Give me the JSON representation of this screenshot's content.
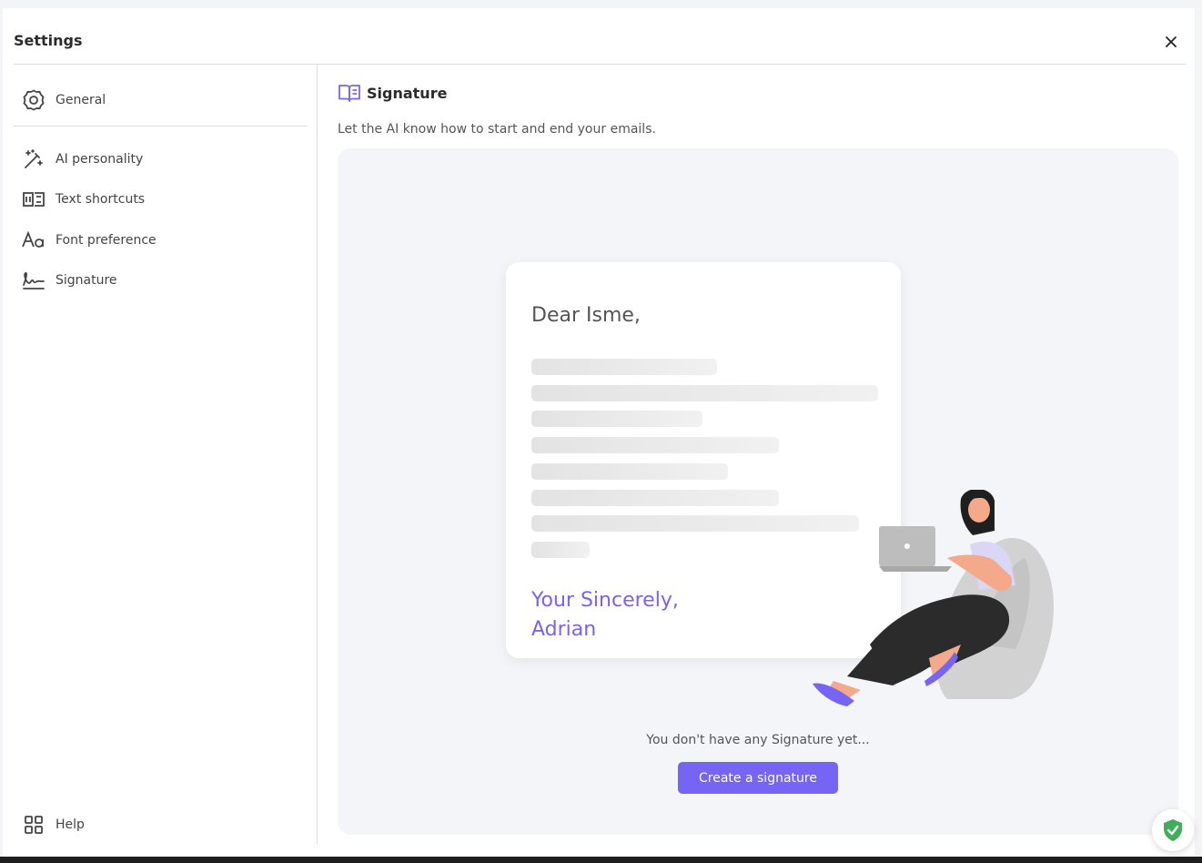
{
  "header": {
    "title": "Settings"
  },
  "sidebar": {
    "items": [
      {
        "label": "General",
        "icon": "gear-icon"
      },
      {
        "label": "AI personality",
        "icon": "magic-wand-icon"
      },
      {
        "label": "Text shortcuts",
        "icon": "text-shortcut-icon"
      },
      {
        "label": "Font preference",
        "icon": "font-icon"
      },
      {
        "label": "Signature",
        "icon": "signature-icon"
      }
    ],
    "help_label": "Help"
  },
  "signature": {
    "title": "Signature",
    "description": "Let the AI know how to start and end your emails.",
    "example": {
      "greeting": "Dear Isme,",
      "closing_line1": "Your Sincerely,",
      "closing_line2": "Adrian"
    },
    "empty_message": "You don't have any Signature yet...",
    "create_button": "Create a signature"
  },
  "colors": {
    "accent": "#7664f4",
    "closing_text": "#7b61f0",
    "panel_bg": "#f4f5f8",
    "shield": "#3fae5a"
  }
}
